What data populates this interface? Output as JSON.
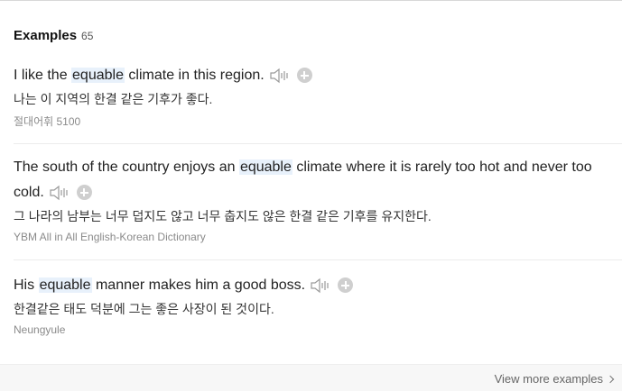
{
  "header": {
    "title": "Examples",
    "count": "65"
  },
  "examples": [
    {
      "en_before": "I like the ",
      "en_highlight": "equable",
      "en_after": " climate in this region.",
      "ko": "나는 이 지역의 한결 같은 기후가 좋다.",
      "source": "절대어휘 5100"
    },
    {
      "en_before": "The south of the country enjoys an ",
      "en_highlight": "equable",
      "en_after": " climate where it is rarely too hot and never too cold.",
      "ko": "그 나라의 남부는 너무 덥지도 않고 너무 춥지도 않은 한결 같은 기후를 유지한다.",
      "source": "YBM All in All English-Korean Dictionary"
    },
    {
      "en_before": "His ",
      "en_highlight": "equable",
      "en_after": " manner makes him a good boss.",
      "ko": "한결같은 태도 덕분에 그는 좋은 사장이 된 것이다.",
      "source": "Neungyule"
    }
  ],
  "footer": {
    "more_label": "View more examples"
  },
  "icons": {
    "audio": "speaker-icon",
    "add": "plus-icon",
    "more": "chevron-right-icon"
  },
  "colors": {
    "highlight": "#e8f1fb",
    "source_text": "#8a8a8a",
    "icon_gray": "#cfcfcf"
  }
}
